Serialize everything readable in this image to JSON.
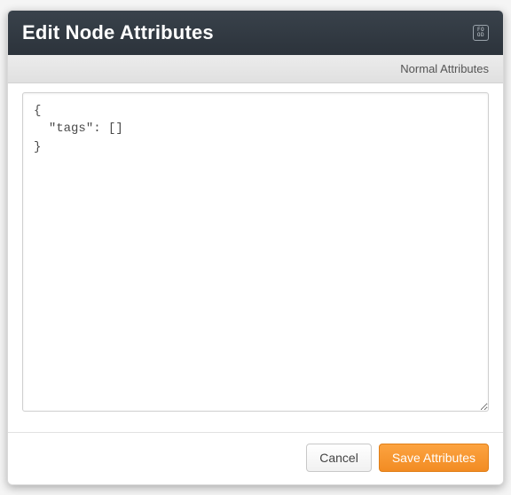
{
  "header": {
    "title": "Edit Node Attributes",
    "icon_label": "food-icon"
  },
  "toolbar": {
    "mode_label": "Normal Attributes"
  },
  "editor": {
    "content": "{\n  \"tags\": []\n}"
  },
  "footer": {
    "cancel_label": "Cancel",
    "save_label": "Save Attributes"
  }
}
